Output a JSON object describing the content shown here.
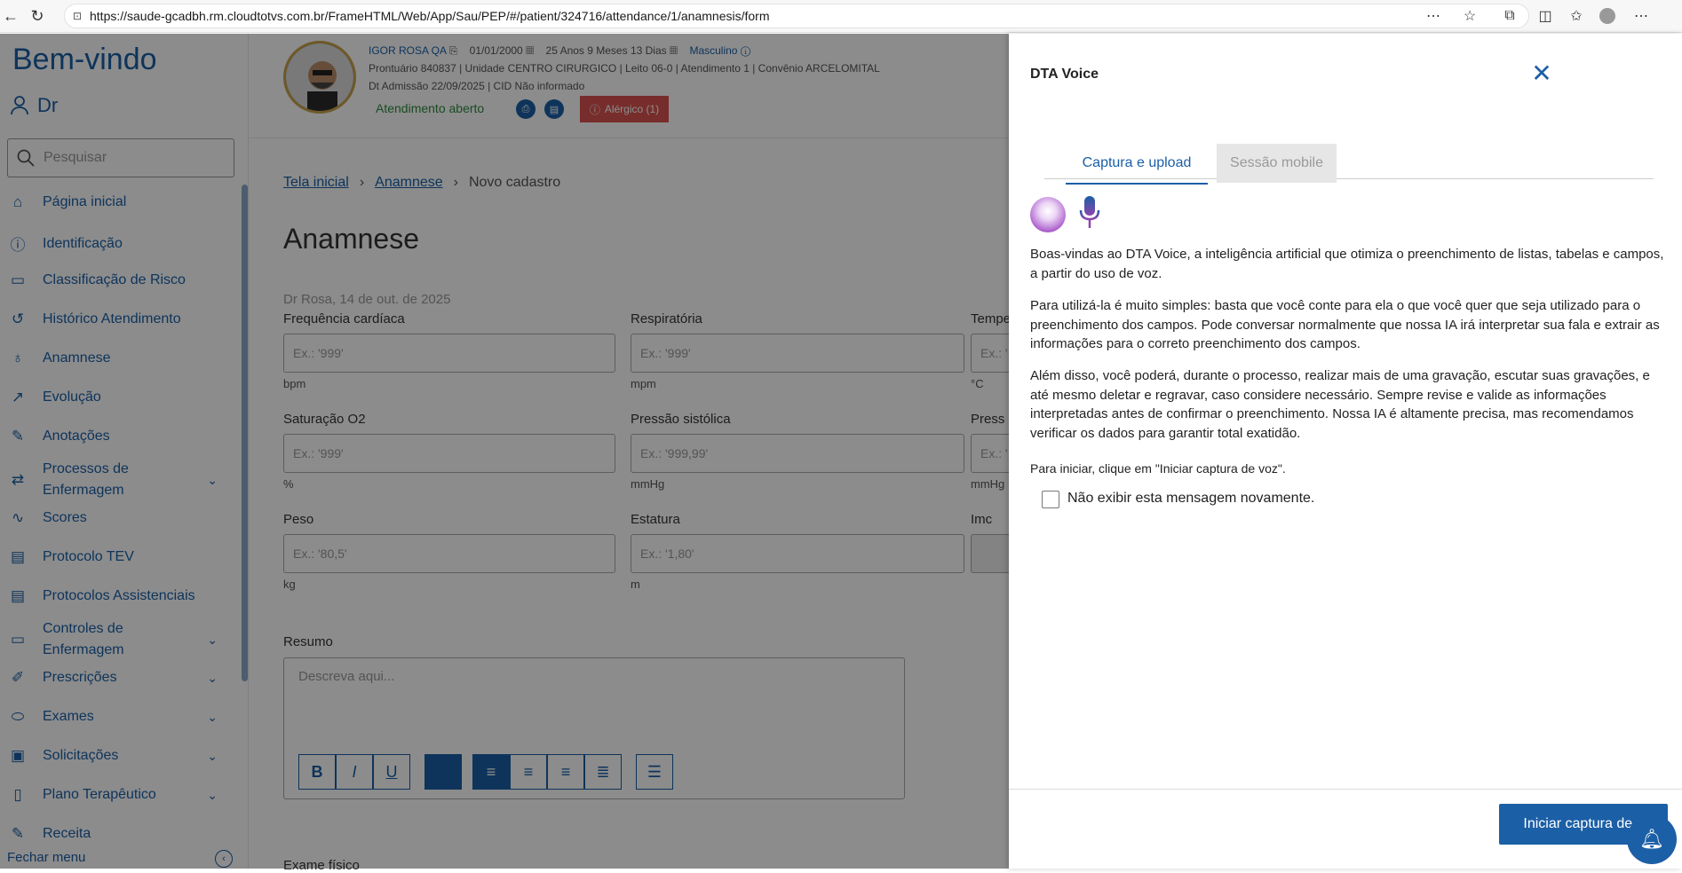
{
  "browser": {
    "url": "https://saude-gcadbh.rm.cloudtotvs.com.br/FrameHTML/Web/App/Sau/PEP/#/patient/324716/attendance/1/anamnesis/form"
  },
  "sidebar": {
    "welcome": "Bem-vindo",
    "user": "Dr",
    "search_placeholder": "Pesquisar",
    "items": [
      {
        "label": "Página inicial"
      },
      {
        "label": "Identificação"
      },
      {
        "label": "Classificação de Risco"
      },
      {
        "label": "Histórico Atendimento"
      },
      {
        "label": "Anamnese"
      },
      {
        "label": "Evolução"
      },
      {
        "label": "Anotações"
      },
      {
        "label": "Processos de Enfermagem"
      },
      {
        "label": "Scores"
      },
      {
        "label": "Protocolo TEV"
      },
      {
        "label": "Protocolos Assistenciais"
      },
      {
        "label": "Controles de Enfermagem"
      },
      {
        "label": "Prescrições"
      },
      {
        "label": "Exames"
      },
      {
        "label": "Solicitações"
      },
      {
        "label": "Plano Terapêutico"
      },
      {
        "label": "Receita"
      }
    ],
    "close_menu": "Fechar menu"
  },
  "patient": {
    "name": "IGOR ROSA QA",
    "birth": "01/01/2000",
    "age": "25 Anos 9 Meses 13 Dias",
    "sex": "Masculino",
    "line2": "Prontuário 840837  |  Unidade CENTRO CIRURGICO  |  Leito 06-0  |  Atendimento 1  |  Convênio ARCELOMITAL",
    "line3": "Dt Admissão 22/09/2025  |  CID Não informado",
    "status": "Atendimento aberto",
    "allergy": "Alérgico (1)"
  },
  "main": {
    "breadcrumb": [
      "Tela inicial",
      "Anamnese",
      "Novo cadastro"
    ],
    "title": "Anamnese",
    "date_line": "Dr Rosa, 14 de out. de 2025",
    "fields": [
      {
        "label": "Frequência cardíaca",
        "placeholder": "Ex.: '999'",
        "unit": "bpm"
      },
      {
        "label": "Respiratória",
        "placeholder": "Ex.: '999'",
        "unit": "mpm"
      },
      {
        "label": "Tempe",
        "placeholder": "Ex.: '",
        "unit": "°C"
      },
      {
        "label": "Saturação O2",
        "placeholder": "Ex.: '999'",
        "unit": "%"
      },
      {
        "label": "Pressão sistólica",
        "placeholder": "Ex.: '999,99'",
        "unit": "mmHg"
      },
      {
        "label": "Press",
        "placeholder": "Ex.: '",
        "unit": "mmHg"
      },
      {
        "label": "Peso",
        "placeholder": "Ex.: '80,5'",
        "unit": "kg"
      },
      {
        "label": "Estatura",
        "placeholder": "Ex.: '1,80'",
        "unit": "m"
      },
      {
        "label": "Imc",
        "placeholder": "",
        "unit": ""
      }
    ],
    "resumo_label": "Resumo",
    "resumo_placeholder": "Descreva aqui...",
    "exame_label": "Exame físico"
  },
  "drawer": {
    "title": "DTA Voice",
    "tabs": [
      "Captura e upload",
      "Sessão mobile"
    ],
    "p1": "Boas-vindas ao DTA Voice, a inteligência artificial que otimiza o preenchimento de listas, tabelas e campos, a partir do uso de voz.",
    "p2": "Para utilizá-la é muito simples: basta que você conte para ela o que você quer que seja utilizado para o preenchimento dos campos. Pode conversar normalmente que nossa IA irá interpretar sua fala e extrair as informações para o correto preenchimento dos campos.",
    "p3": "Além disso, você poderá, durante o processo, realizar mais de uma gravação, escutar suas gravações, e até mesmo deletar e regravar, caso considere necessário. Sempre revise e valide as informações interpretadas antes de confirmar o preenchimento. Nossa IA é altamente precisa, mas recomendamos verificar os dados para garantir total exatidão.",
    "start_text": "Para iniciar, clique em \"Iniciar captura de voz\".",
    "checkbox_label": "Não exibir esta mensagem novamente.",
    "start_button": "Iniciar captura de v"
  }
}
